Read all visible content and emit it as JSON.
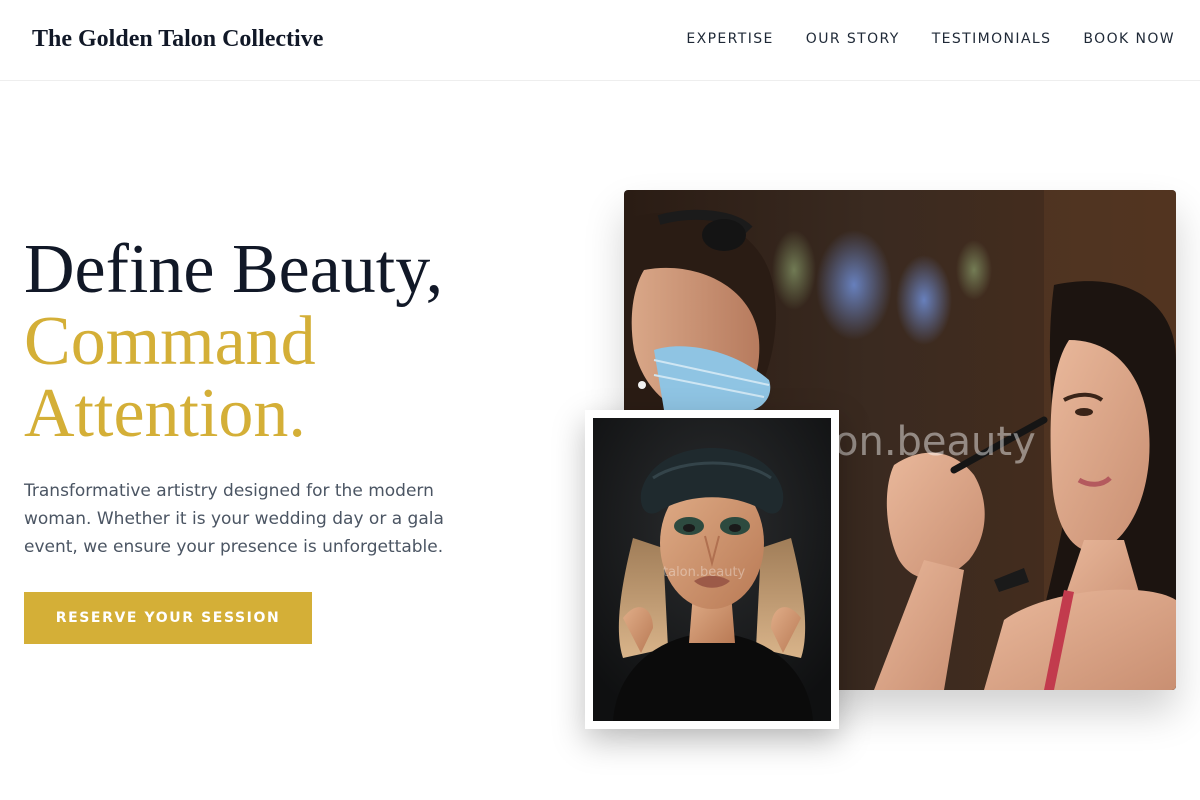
{
  "header": {
    "brand": "The Golden Talon Collective",
    "nav": [
      "EXPERTISE",
      "OUR STORY",
      "TESTIMONIALS",
      "BOOK NOW"
    ]
  },
  "hero": {
    "headline_line1": "Define Beauty,",
    "headline_line2": "Command",
    "headline_line3": "Attention.",
    "lede": "Transformative artistry designed for the modern woman. Whether it is your wedding day or a gala event, we ensure your presence is unforgettable.",
    "cta_label": "RESERVE YOUR SESSION"
  },
  "images": {
    "main_watermark": "on.beauty",
    "inset_watermark": "talon.beauty"
  },
  "colors": {
    "accent_gold": "#d4af37",
    "ink": "#111827",
    "body_text": "#4b5563"
  }
}
